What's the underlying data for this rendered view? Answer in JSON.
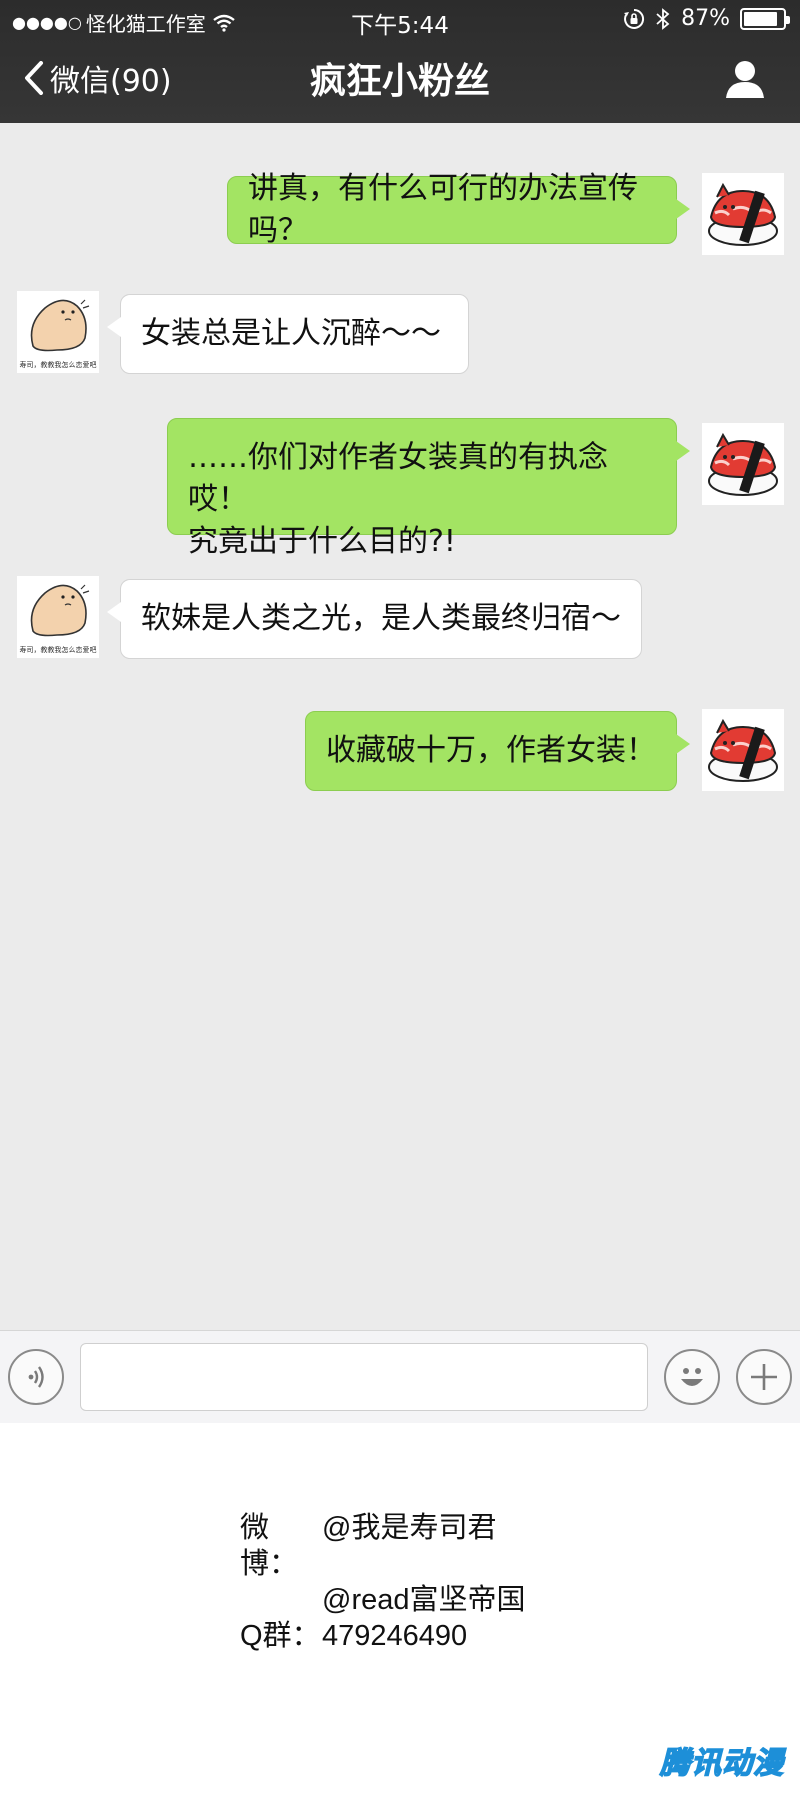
{
  "status_bar": {
    "signal_dots": "●●●●○",
    "carrier": "怪化猫工作室",
    "time": "下午5:44",
    "battery": "87%",
    "battery_level": 0.87
  },
  "nav": {
    "back_label": "微信(90)",
    "title": "疯狂小粉丝"
  },
  "messages": [
    {
      "side": "right",
      "text": "讲真，有什么可行的办法宣传吗？"
    },
    {
      "side": "left",
      "text": "女装总是让人沉醉～～",
      "avatar_caption": "寿司，教教我怎么恋爱吧"
    },
    {
      "side": "right",
      "text": "……你们对作者女装真的有执念哎！\n究竟出于什么目的?!"
    },
    {
      "side": "left",
      "text": "软妹是人类之光，是人类最终归宿～",
      "avatar_caption": "寿司，教教我怎么恋爱吧"
    },
    {
      "side": "right",
      "text": "收藏破十万，作者女装！"
    }
  ],
  "input": {
    "value": "",
    "placeholder": ""
  },
  "footer": {
    "weibo_label": "微博：",
    "weibo_1": "@我是寿司君",
    "weibo_2": "@read富坚帝国",
    "qq_label": "Q群：",
    "qq_number": "479246490",
    "watermark": "腾讯动漫"
  },
  "colors": {
    "header": "#333333",
    "chat_bg": "#ebebeb",
    "bubble_right": "#a3e463",
    "bubble_left": "#ffffff"
  },
  "icons": {
    "back": "chevron-left-icon",
    "profile": "person-icon",
    "voice": "voice-icon",
    "emoji": "emoji-icon",
    "plus": "plus-icon",
    "wifi": "wifi-icon",
    "rotation_lock": "rotation-lock-icon",
    "bluetooth": "bluetooth-icon"
  }
}
